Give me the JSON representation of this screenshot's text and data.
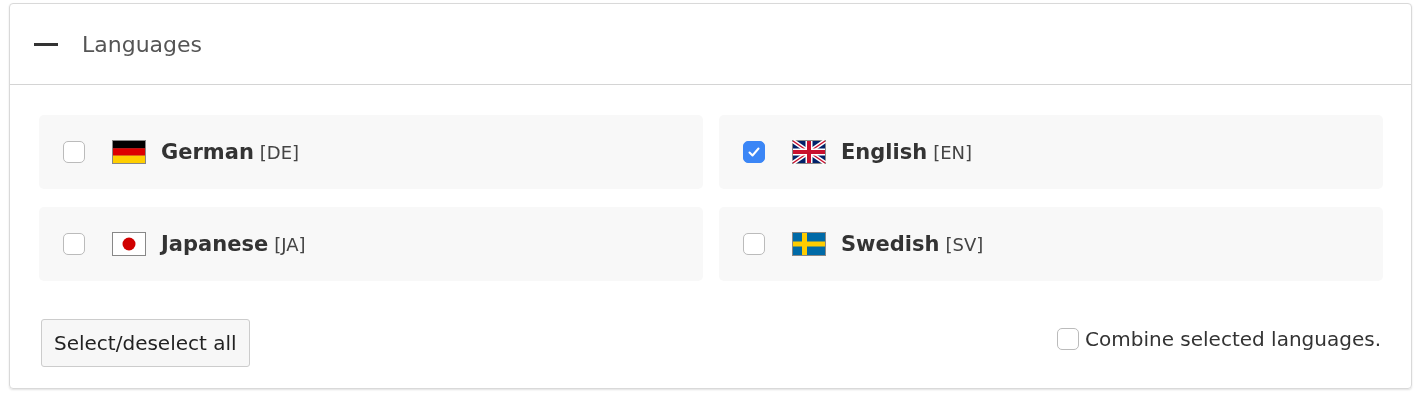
{
  "panel": {
    "title": "Languages",
    "expanded": true
  },
  "languages": [
    {
      "name": "German",
      "code": "[DE]",
      "checked": false
    },
    {
      "name": "English",
      "code": "[EN]",
      "checked": true
    },
    {
      "name": "Japanese",
      "code": "[JA]",
      "checked": false
    },
    {
      "name": "Swedish",
      "code": "[SV]",
      "checked": false
    }
  ],
  "select_all_button": "Select/deselect all",
  "combine": {
    "label": "Combine selected languages.",
    "checked": false
  }
}
